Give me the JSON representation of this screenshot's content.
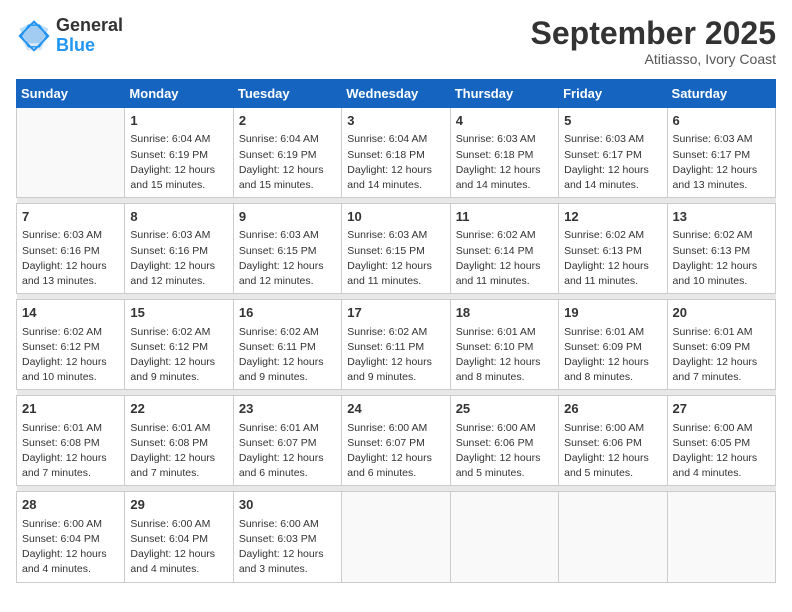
{
  "header": {
    "logo_general": "General",
    "logo_blue": "Blue",
    "title": "September 2025",
    "subtitle": "Atitiasso, Ivory Coast"
  },
  "days_of_week": [
    "Sunday",
    "Monday",
    "Tuesday",
    "Wednesday",
    "Thursday",
    "Friday",
    "Saturday"
  ],
  "weeks": [
    [
      {
        "day": "",
        "sunrise": "",
        "sunset": "",
        "daylight": ""
      },
      {
        "day": "1",
        "sunrise": "Sunrise: 6:04 AM",
        "sunset": "Sunset: 6:19 PM",
        "daylight": "Daylight: 12 hours and 15 minutes."
      },
      {
        "day": "2",
        "sunrise": "Sunrise: 6:04 AM",
        "sunset": "Sunset: 6:19 PM",
        "daylight": "Daylight: 12 hours and 15 minutes."
      },
      {
        "day": "3",
        "sunrise": "Sunrise: 6:04 AM",
        "sunset": "Sunset: 6:18 PM",
        "daylight": "Daylight: 12 hours and 14 minutes."
      },
      {
        "day": "4",
        "sunrise": "Sunrise: 6:03 AM",
        "sunset": "Sunset: 6:18 PM",
        "daylight": "Daylight: 12 hours and 14 minutes."
      },
      {
        "day": "5",
        "sunrise": "Sunrise: 6:03 AM",
        "sunset": "Sunset: 6:17 PM",
        "daylight": "Daylight: 12 hours and 14 minutes."
      },
      {
        "day": "6",
        "sunrise": "Sunrise: 6:03 AM",
        "sunset": "Sunset: 6:17 PM",
        "daylight": "Daylight: 12 hours and 13 minutes."
      }
    ],
    [
      {
        "day": "7",
        "sunrise": "Sunrise: 6:03 AM",
        "sunset": "Sunset: 6:16 PM",
        "daylight": "Daylight: 12 hours and 13 minutes."
      },
      {
        "day": "8",
        "sunrise": "Sunrise: 6:03 AM",
        "sunset": "Sunset: 6:16 PM",
        "daylight": "Daylight: 12 hours and 12 minutes."
      },
      {
        "day": "9",
        "sunrise": "Sunrise: 6:03 AM",
        "sunset": "Sunset: 6:15 PM",
        "daylight": "Daylight: 12 hours and 12 minutes."
      },
      {
        "day": "10",
        "sunrise": "Sunrise: 6:03 AM",
        "sunset": "Sunset: 6:15 PM",
        "daylight": "Daylight: 12 hours and 11 minutes."
      },
      {
        "day": "11",
        "sunrise": "Sunrise: 6:02 AM",
        "sunset": "Sunset: 6:14 PM",
        "daylight": "Daylight: 12 hours and 11 minutes."
      },
      {
        "day": "12",
        "sunrise": "Sunrise: 6:02 AM",
        "sunset": "Sunset: 6:13 PM",
        "daylight": "Daylight: 12 hours and 11 minutes."
      },
      {
        "day": "13",
        "sunrise": "Sunrise: 6:02 AM",
        "sunset": "Sunset: 6:13 PM",
        "daylight": "Daylight: 12 hours and 10 minutes."
      }
    ],
    [
      {
        "day": "14",
        "sunrise": "Sunrise: 6:02 AM",
        "sunset": "Sunset: 6:12 PM",
        "daylight": "Daylight: 12 hours and 10 minutes."
      },
      {
        "day": "15",
        "sunrise": "Sunrise: 6:02 AM",
        "sunset": "Sunset: 6:12 PM",
        "daylight": "Daylight: 12 hours and 9 minutes."
      },
      {
        "day": "16",
        "sunrise": "Sunrise: 6:02 AM",
        "sunset": "Sunset: 6:11 PM",
        "daylight": "Daylight: 12 hours and 9 minutes."
      },
      {
        "day": "17",
        "sunrise": "Sunrise: 6:02 AM",
        "sunset": "Sunset: 6:11 PM",
        "daylight": "Daylight: 12 hours and 9 minutes."
      },
      {
        "day": "18",
        "sunrise": "Sunrise: 6:01 AM",
        "sunset": "Sunset: 6:10 PM",
        "daylight": "Daylight: 12 hours and 8 minutes."
      },
      {
        "day": "19",
        "sunrise": "Sunrise: 6:01 AM",
        "sunset": "Sunset: 6:09 PM",
        "daylight": "Daylight: 12 hours and 8 minutes."
      },
      {
        "day": "20",
        "sunrise": "Sunrise: 6:01 AM",
        "sunset": "Sunset: 6:09 PM",
        "daylight": "Daylight: 12 hours and 7 minutes."
      }
    ],
    [
      {
        "day": "21",
        "sunrise": "Sunrise: 6:01 AM",
        "sunset": "Sunset: 6:08 PM",
        "daylight": "Daylight: 12 hours and 7 minutes."
      },
      {
        "day": "22",
        "sunrise": "Sunrise: 6:01 AM",
        "sunset": "Sunset: 6:08 PM",
        "daylight": "Daylight: 12 hours and 7 minutes."
      },
      {
        "day": "23",
        "sunrise": "Sunrise: 6:01 AM",
        "sunset": "Sunset: 6:07 PM",
        "daylight": "Daylight: 12 hours and 6 minutes."
      },
      {
        "day": "24",
        "sunrise": "Sunrise: 6:00 AM",
        "sunset": "Sunset: 6:07 PM",
        "daylight": "Daylight: 12 hours and 6 minutes."
      },
      {
        "day": "25",
        "sunrise": "Sunrise: 6:00 AM",
        "sunset": "Sunset: 6:06 PM",
        "daylight": "Daylight: 12 hours and 5 minutes."
      },
      {
        "day": "26",
        "sunrise": "Sunrise: 6:00 AM",
        "sunset": "Sunset: 6:06 PM",
        "daylight": "Daylight: 12 hours and 5 minutes."
      },
      {
        "day": "27",
        "sunrise": "Sunrise: 6:00 AM",
        "sunset": "Sunset: 6:05 PM",
        "daylight": "Daylight: 12 hours and 4 minutes."
      }
    ],
    [
      {
        "day": "28",
        "sunrise": "Sunrise: 6:00 AM",
        "sunset": "Sunset: 6:04 PM",
        "daylight": "Daylight: 12 hours and 4 minutes."
      },
      {
        "day": "29",
        "sunrise": "Sunrise: 6:00 AM",
        "sunset": "Sunset: 6:04 PM",
        "daylight": "Daylight: 12 hours and 4 minutes."
      },
      {
        "day": "30",
        "sunrise": "Sunrise: 6:00 AM",
        "sunset": "Sunset: 6:03 PM",
        "daylight": "Daylight: 12 hours and 3 minutes."
      },
      {
        "day": "",
        "sunrise": "",
        "sunset": "",
        "daylight": ""
      },
      {
        "day": "",
        "sunrise": "",
        "sunset": "",
        "daylight": ""
      },
      {
        "day": "",
        "sunrise": "",
        "sunset": "",
        "daylight": ""
      },
      {
        "day": "",
        "sunrise": "",
        "sunset": "",
        "daylight": ""
      }
    ]
  ]
}
